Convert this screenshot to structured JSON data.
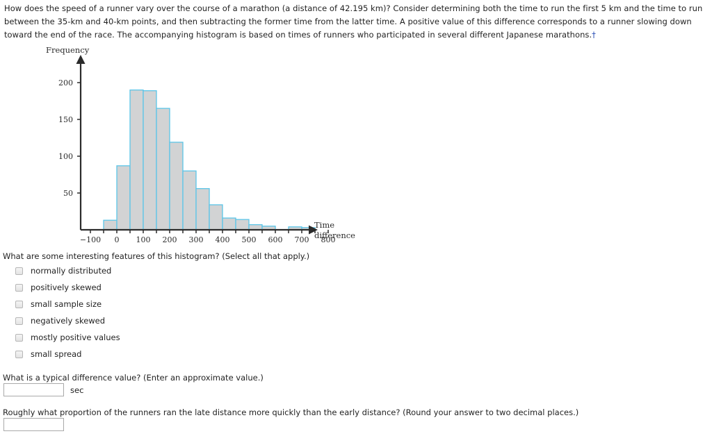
{
  "intro": {
    "paragraph": "How does the speed of a runner vary over the course of a marathon (a distance of 42.195 km)? Consider determining both the time to run the first 5 km and the time to run between the 35-km and 40-km points, and then subtracting the former time from the latter time. A positive value of this difference corresponds to a runner slowing down toward the end of the race. The accompanying histogram is based on times of runners who participated in several different Japanese marathons.",
    "footnote_marker": "†"
  },
  "chart_data": {
    "type": "bar",
    "subtype": "histogram",
    "title": "",
    "xlabel": "Time difference",
    "ylabel": "Frequency",
    "xlim": [
      -100,
      870
    ],
    "ylim": [
      0,
      215
    ],
    "bin_width": 50,
    "grid": false,
    "legend": "none",
    "xticks": [
      -100,
      0,
      100,
      200,
      300,
      400,
      500,
      600,
      700,
      800
    ],
    "xtick_labels": [
      "−100",
      "0",
      "100",
      "200",
      "300",
      "400",
      "500",
      "600",
      "700",
      "800"
    ],
    "minor_xticks": [
      -50,
      50,
      150,
      250,
      350,
      450,
      550,
      650,
      750
    ],
    "yticks": [
      50,
      100,
      150,
      200
    ],
    "ytick_labels": [
      "50",
      "100",
      "150",
      "200"
    ],
    "bar_fill": "#d2d3d4",
    "bar_stroke": "#5bc5e8",
    "axis_color": "#2b2b2b",
    "bins": [
      {
        "start": -50,
        "end": 0,
        "value": 13
      },
      {
        "start": 0,
        "end": 50,
        "value": 87
      },
      {
        "start": 50,
        "end": 100,
        "value": 190
      },
      {
        "start": 100,
        "end": 150,
        "value": 189
      },
      {
        "start": 150,
        "end": 200,
        "value": 165
      },
      {
        "start": 200,
        "end": 250,
        "value": 119
      },
      {
        "start": 250,
        "end": 300,
        "value": 80
      },
      {
        "start": 300,
        "end": 350,
        "value": 56
      },
      {
        "start": 350,
        "end": 400,
        "value": 34
      },
      {
        "start": 400,
        "end": 450,
        "value": 16
      },
      {
        "start": 450,
        "end": 500,
        "value": 14
      },
      {
        "start": 500,
        "end": 550,
        "value": 7
      },
      {
        "start": 550,
        "end": 600,
        "value": 5
      },
      {
        "start": 650,
        "end": 700,
        "value": 4
      },
      {
        "start": 700,
        "end": 750,
        "value": 3
      }
    ],
    "categories": [
      "-50 to 0",
      "0 to 50",
      "50 to 100",
      "100 to 150",
      "150 to 200",
      "200 to 250",
      "250 to 300",
      "300 to 350",
      "350 to 400",
      "400 to 450",
      "450 to 500",
      "500 to 550",
      "550 to 600",
      "600 to 650",
      "650 to 700",
      "700 to 750"
    ],
    "values": [
      13,
      87,
      190,
      189,
      165,
      119,
      80,
      56,
      34,
      16,
      14,
      7,
      5,
      0,
      4,
      3
    ]
  },
  "questions": {
    "q1": {
      "prompt": "What are some interesting features of this histogram? (Select all that apply.)",
      "options": [
        {
          "label": "normally distributed",
          "checked": false
        },
        {
          "label": "positively skewed",
          "checked": false
        },
        {
          "label": "small sample size",
          "checked": false
        },
        {
          "label": "negatively skewed",
          "checked": false
        },
        {
          "label": "mostly positive values",
          "checked": false
        },
        {
          "label": "small spread",
          "checked": false
        }
      ]
    },
    "q2": {
      "prompt": "What is a typical difference value? (Enter an approximate value.)",
      "value": "",
      "unit": "sec"
    },
    "q3": {
      "prompt": "Roughly what proportion of the runners ran the late distance more quickly than the early distance? (Round your answer to two decimal places.)",
      "value": ""
    }
  }
}
